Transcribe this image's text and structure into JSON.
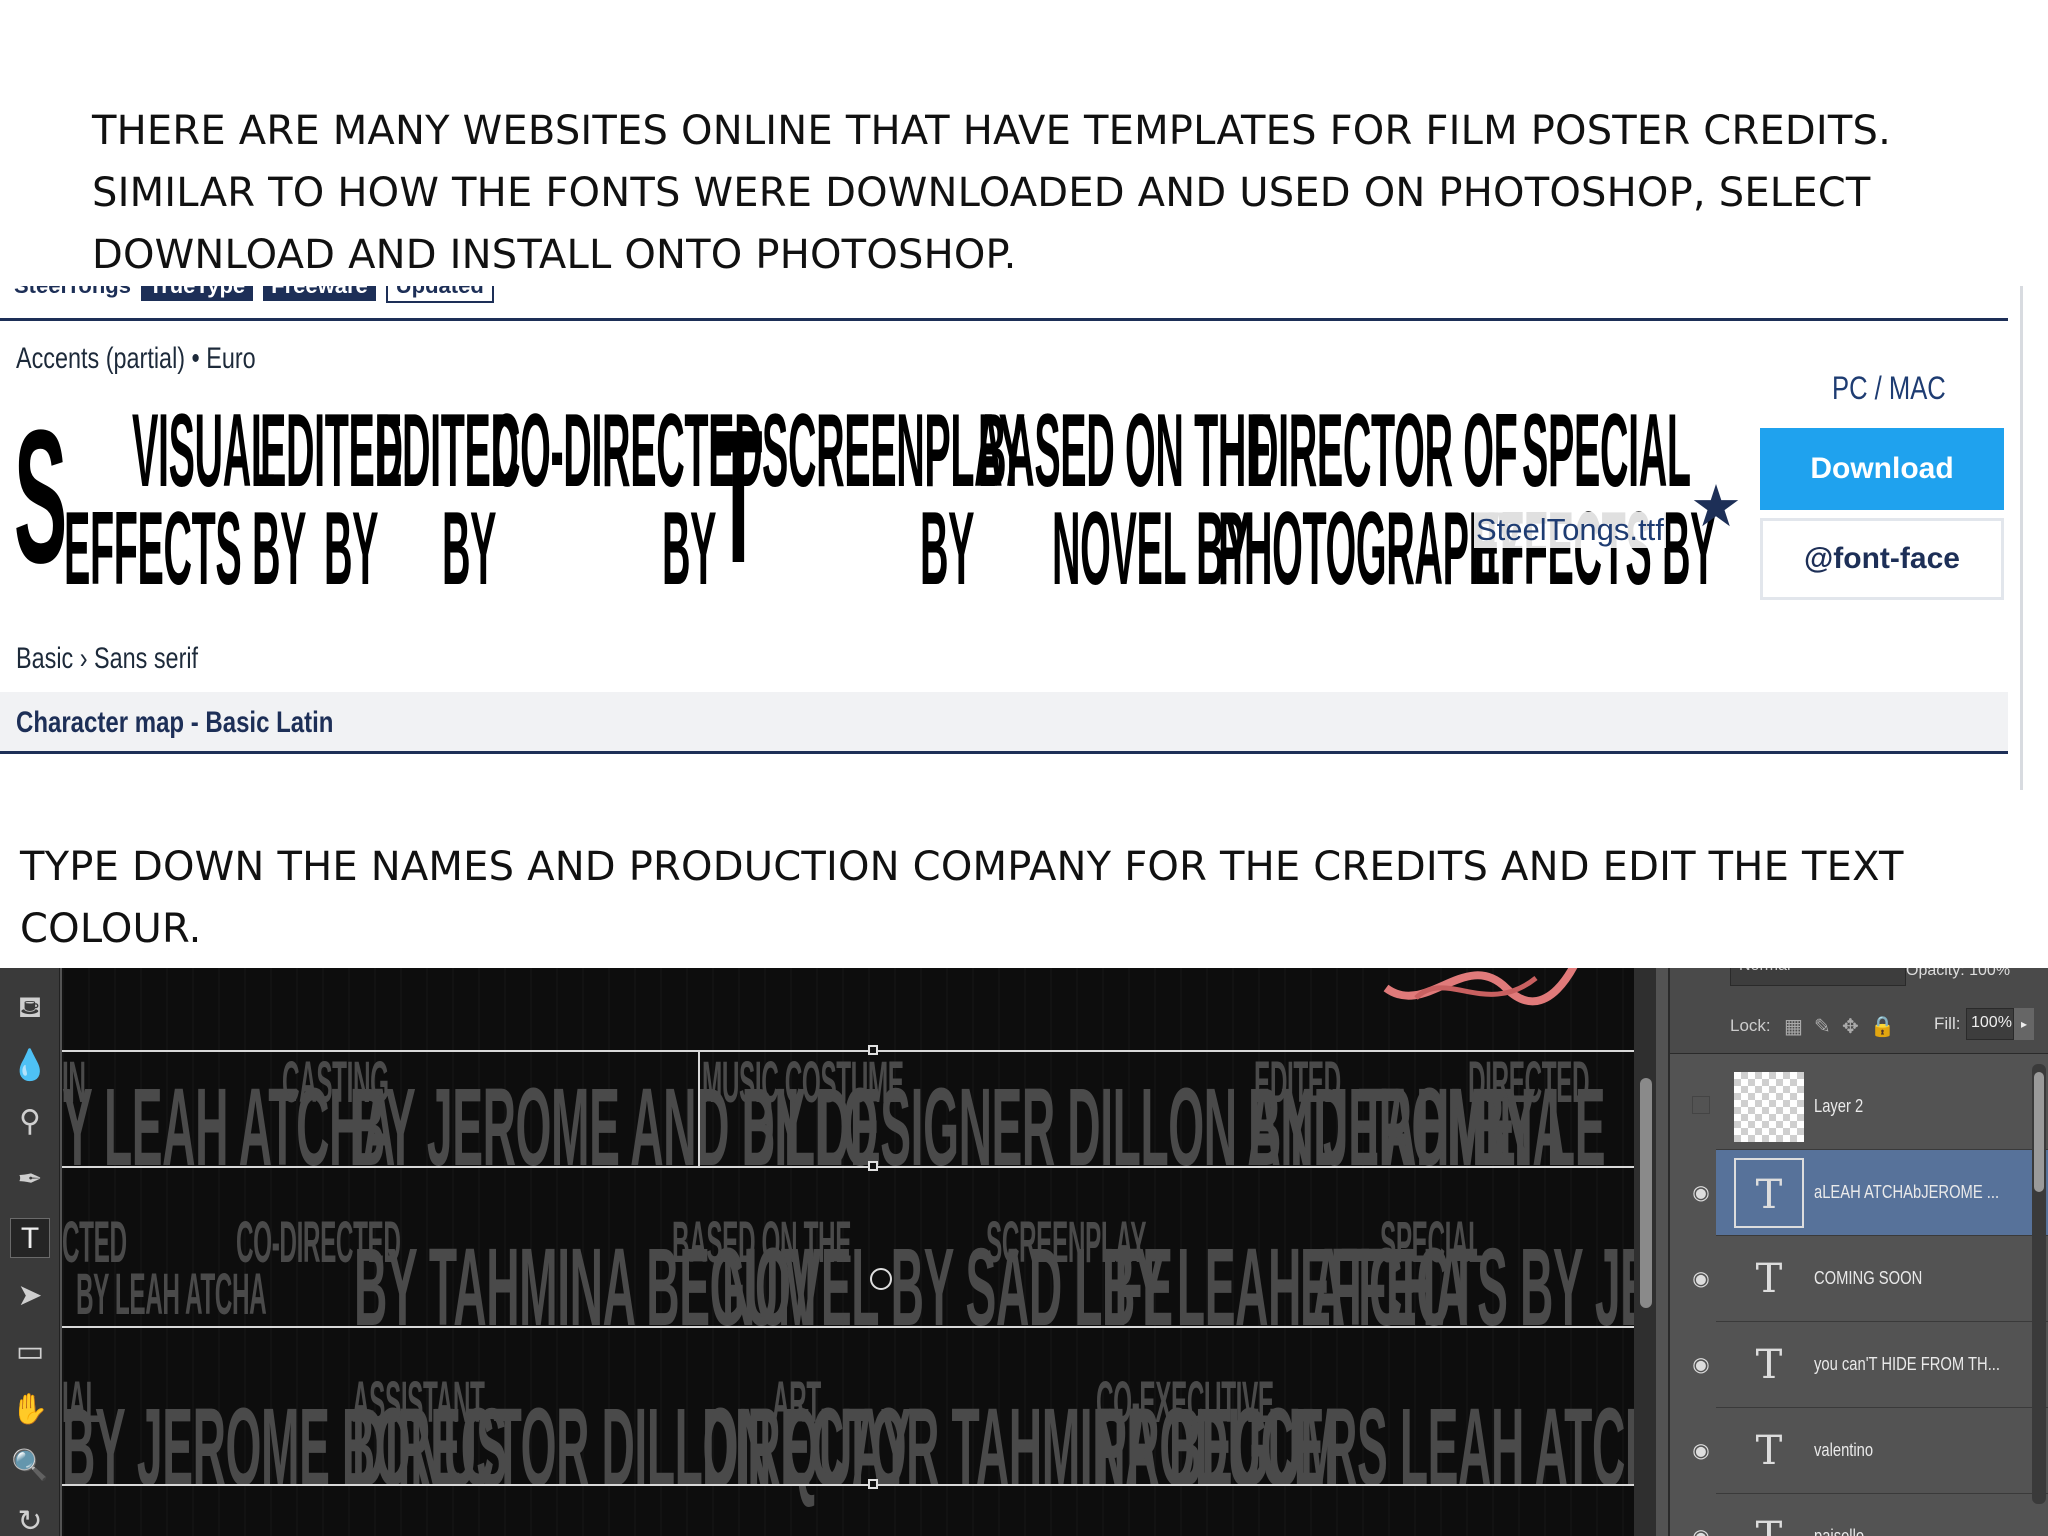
{
  "instructions": {
    "step1": "THERE ARE MANY WEBSITES ONLINE THAT HAVE TEMPLATES FOR FILM POSTER CREDITS. SIMILAR TO HOW THE FONTS WERE DOWNLOADED AND USED ON PHOTOSHOP, SELECT DOWNLOAD AND INSTALL ONTO PHOTOSHOP.",
    "step2": "TYPE DOWN THE NAMES AND PRODUCTION COMPANY FOR THE CREDITS AND EDIT THE TEXT COLOUR."
  },
  "font_site": {
    "breadcrumb": [
      "SteelTongs",
      "TrueType",
      "Freeware",
      "Updated"
    ],
    "accents": "Accents (partial) • Euro",
    "preview": {
      "s_initial": "S",
      "t_initial": "T",
      "line1": [
        "VISUAL",
        "EDITED",
        "EDITED",
        "CO-DIRECTED",
        "SCREENPLAY",
        "BASED ON THE",
        "DIRECTOR OF",
        "SPECIAL"
      ],
      "line2": [
        "EFFECTS BY",
        "BY",
        "BY",
        "BY",
        "BY",
        "NOVEL BY",
        "PHOTOGRAPHY",
        "EFFECTS BY"
      ]
    },
    "filename": "SteelTongs.ttf",
    "platform": "PC / MAC",
    "download_label": "Download",
    "fontface_label": "@font-face",
    "classification": "Basic › Sans serif",
    "charmap_label": "Character map - Basic Latin",
    "accent_color": "#1fa2ee",
    "brand_color": "#1d2f57"
  },
  "photoshop": {
    "tools": [
      "paint-bucket-icon",
      "blur-icon",
      "dodge-icon",
      "pen-icon",
      "type-icon",
      "path-selection-icon",
      "rectangle-icon",
      "hand-icon",
      "zoom-icon"
    ],
    "credits": {
      "row1": [
        {
          "small": "IN",
          "big": "Y LEAH ATCHA"
        },
        {
          "small": "CASTING",
          "big": "BY JEROME AND DILLO"
        },
        {
          "small": "MUSIC COSTUME",
          "big": "BY DESIGNER DILLON AND TAHMINA"
        },
        {
          "small": "EDITED",
          "big": "BY JEROME"
        },
        {
          "small": "DIRECTED",
          "big": "BY LE"
        }
      ],
      "row2": [
        {
          "small": "CTED",
          "big": "BY LEAH ATCHA"
        },
        {
          "small": "CO-DIRECTED",
          "big": "BY TAHMINA BEGUM"
        },
        {
          "small": "BASED ON THE",
          "big": "NOVEL BY SAD LIFE"
        },
        {
          "small": "SCREENPLAY",
          "big": "BY LEAH ATCHA"
        },
        {
          "small": "SPECIAL",
          "big": "EFFECTS BY JEROME"
        }
      ],
      "row3": [
        {
          "small": "IAL",
          "big": "BY JEROME BONUS"
        },
        {
          "small": "ASSISTANT",
          "big": "DIRECTOR DILLON QUAY"
        },
        {
          "small": "ART",
          "big": "DIRECTOR TAHMINA BEGUM"
        },
        {
          "small": "CO-EXECUTIVE",
          "big": "PRODUCERS LEAH ATCHA& TAHMIN"
        }
      ]
    },
    "layers_panel": {
      "blend_mode": "Normal",
      "opacity": "Opacity: 100%",
      "lock_label": "Lock:",
      "fill_label": "Fill:",
      "fill_value": "100%",
      "layers": [
        {
          "name": "Layer 2",
          "thumb": "",
          "visible": false,
          "selected": false
        },
        {
          "name": "aLEAH ATCHAbJEROME ...",
          "thumb": "T",
          "visible": true,
          "selected": true
        },
        {
          "name": "COMING SOON",
          "thumb": "T",
          "visible": true,
          "selected": false
        },
        {
          "name": "you can'T HIDE FROM TH...",
          "thumb": "T",
          "visible": true,
          "selected": false
        },
        {
          "name": "valentino",
          "thumb": "T",
          "visible": true,
          "selected": false
        },
        {
          "name": "paisello",
          "thumb": "T",
          "visible": true,
          "selected": false
        }
      ],
      "selection_color": "#57729a"
    }
  }
}
